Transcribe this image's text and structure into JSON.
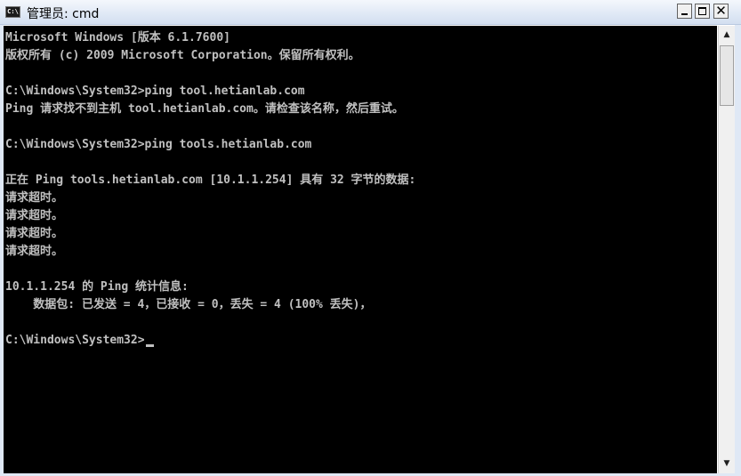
{
  "window": {
    "title": "管理员: cmd",
    "icon_text": "C:\\",
    "minimize_icon": "minimize-icon",
    "maximize_icon": "maximize-icon",
    "close_label": "✕"
  },
  "console": {
    "lines": [
      "Microsoft Windows [版本 6.1.7600]",
      "版权所有 (c) 2009 Microsoft Corporation。保留所有权利。",
      "",
      "C:\\Windows\\System32>ping tool.hetianlab.com",
      "Ping 请求找不到主机 tool.hetianlab.com。请检查该名称，然后重试。",
      "",
      "C:\\Windows\\System32>ping tools.hetianlab.com",
      "",
      "正在 Ping tools.hetianlab.com [10.1.1.254] 具有 32 字节的数据:",
      "请求超时。",
      "请求超时。",
      "请求超时。",
      "请求超时。",
      "",
      "10.1.1.254 的 Ping 统计信息:",
      "    数据包: 已发送 = 4，已接收 = 0，丢失 = 4 (100% 丢失)，",
      "",
      "C:\\Windows\\System32>"
    ]
  },
  "scrollbar": {
    "up_arrow": "▲",
    "down_arrow": "▼"
  }
}
